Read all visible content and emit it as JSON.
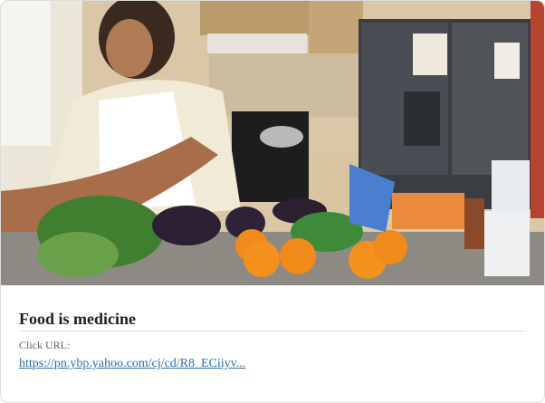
{
  "card": {
    "image_alt": "Woman preparing vegetables at a kitchen counter",
    "title": "Food is medicine",
    "click_url_label": "Click URL:",
    "click_url": "https://pn.ybp.yahoo.com/cj/cd/R8_ECiiyv..."
  },
  "colors": {
    "title": "#1f1f1f",
    "label": "#666666",
    "link": "#2a6fb0",
    "border": "#dcdcdc"
  }
}
